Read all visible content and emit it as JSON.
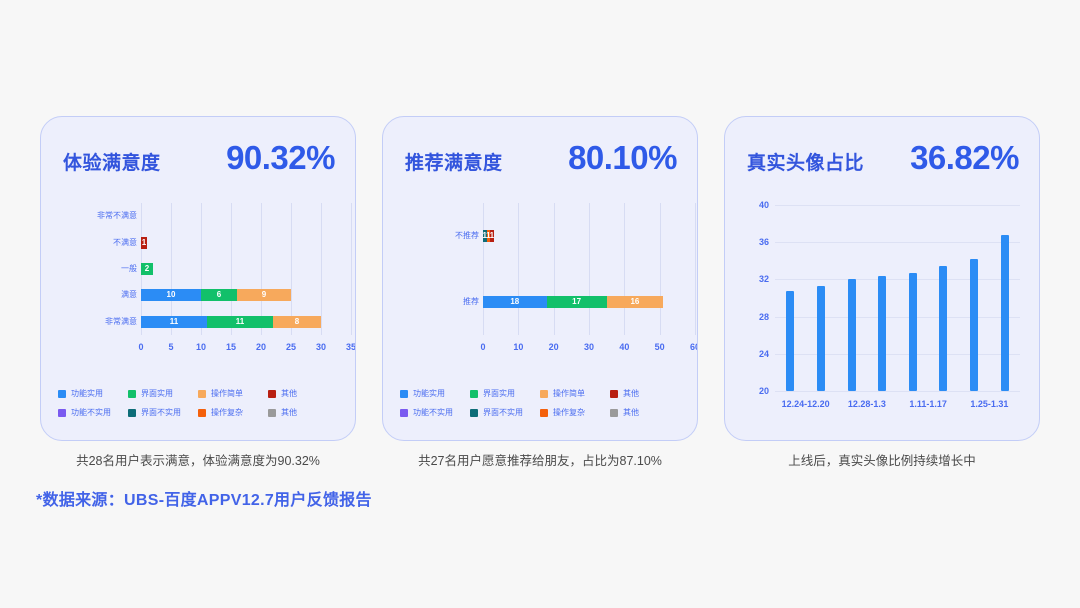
{
  "palette": {
    "page_bg": "#f7f7f7",
    "card_bg": "#edeffc",
    "card_border": "#c3cdf7",
    "accent_blue": "#2f5ae8",
    "title_blue": "#3355dd",
    "label_blue": "#4a6cf0",
    "bar_blue": "#2b8cf5",
    "bar_green": "#12c06a",
    "bar_orange": "#f7a95c",
    "bar_darkred": "#b81f12",
    "bar_purple": "#7a5af0",
    "bar_teal": "#0d6d78",
    "bar_deeporange": "#f4600c",
    "bar_gray": "#9a9a9a"
  },
  "legend_items": [
    {
      "label": "功能实用",
      "color": "#2b8cf5"
    },
    {
      "label": "界面实用",
      "color": "#12c06a"
    },
    {
      "label": "操作简单",
      "color": "#f7a95c"
    },
    {
      "label": "其他",
      "color": "#b81f12"
    },
    {
      "label": "功能不实用",
      "color": "#7a5af0"
    },
    {
      "label": "界面不实用",
      "color": "#0d6d78"
    },
    {
      "label": "操作复杂",
      "color": "#f4600c"
    },
    {
      "label": "其他",
      "color": "#9a9a9a"
    }
  ],
  "cards": [
    {
      "id": "experience-satisfaction",
      "title": "体验满意度",
      "percent": "90.32%",
      "caption": "共28名用户表示满意，体验满意度为90.32%",
      "chart_data": {
        "type": "bar",
        "orientation": "horizontal",
        "stacked": true,
        "title": "体验满意度",
        "xlabel": "",
        "ylabel": "",
        "xlim": [
          0,
          35
        ],
        "xticks": [
          0,
          5,
          10,
          15,
          20,
          25,
          30,
          35
        ],
        "grid": true,
        "categories": [
          "非常不满意",
          "不满意",
          "一般",
          "满意",
          "非常满意"
        ],
        "series": [
          {
            "name": "功能实用",
            "color": "#2b8cf5",
            "values": [
              0,
              0,
              0,
              10,
              11
            ]
          },
          {
            "name": "界面实用",
            "color": "#12c06a",
            "values": [
              0,
              0,
              2,
              6,
              11
            ]
          },
          {
            "name": "操作简单",
            "color": "#f7a95c",
            "values": [
              0,
              0,
              0,
              9,
              8
            ]
          },
          {
            "name": "其他",
            "color": "#b81f12",
            "values": [
              0,
              1,
              0,
              0,
              0
            ]
          },
          {
            "name": "功能不实用",
            "color": "#7a5af0",
            "values": [
              0,
              0,
              0,
              0,
              0
            ]
          },
          {
            "name": "界面不实用",
            "color": "#0d6d78",
            "values": [
              0,
              0,
              0,
              0,
              0
            ]
          },
          {
            "name": "操作复杂",
            "color": "#f4600c",
            "values": [
              0,
              0,
              0,
              0,
              0
            ]
          },
          {
            "name": "其他2",
            "color": "#9a9a9a",
            "values": [
              0,
              0,
              0,
              0,
              0
            ]
          }
        ]
      }
    },
    {
      "id": "recommend-satisfaction",
      "title": "推荐满意度",
      "percent": "80.10%",
      "caption": "共27名用户愿意推荐给朋友，占比为87.10%",
      "chart_data": {
        "type": "bar",
        "orientation": "horizontal",
        "stacked": true,
        "title": "推荐满意度",
        "xlabel": "",
        "ylabel": "",
        "xlim": [
          0,
          60
        ],
        "xticks": [
          0,
          10,
          20,
          30,
          40,
          50,
          60
        ],
        "grid": true,
        "categories": [
          "不推荐",
          "推荐"
        ],
        "series": [
          {
            "name": "功能实用",
            "color": "#2b8cf5",
            "values": [
              0,
              18
            ]
          },
          {
            "name": "界面实用",
            "color": "#12c06a",
            "values": [
              0,
              17
            ]
          },
          {
            "name": "操作简单",
            "color": "#f7a95c",
            "values": [
              0,
              16
            ]
          },
          {
            "name": "界面不实用",
            "color": "#0d6d78",
            "values": [
              1,
              0
            ]
          },
          {
            "name": "操作复杂",
            "color": "#f4600c",
            "values": [
              1,
              0
            ]
          },
          {
            "name": "其他",
            "color": "#b81f12",
            "values": [
              1,
              0
            ]
          }
        ]
      }
    },
    {
      "id": "real-avatar-ratio",
      "title": "真实头像占比",
      "percent": "36.82%",
      "caption": "上线后，真实头像比例持续增长中",
      "chart_data": {
        "type": "bar",
        "orientation": "vertical",
        "title": "真实头像占比",
        "xlabel": "",
        "ylabel": "",
        "ylim": [
          20,
          40
        ],
        "yticks": [
          20,
          24,
          28,
          32,
          36,
          40
        ],
        "grid": true,
        "categories": [
          "12.24-12.20",
          "",
          "12.28-1.3",
          "",
          "1.11-1.17",
          "",
          "1.25-1.31",
          ""
        ],
        "xtick_labels": [
          "12.24-12.20",
          "12.28-1.3",
          "1.11-1.17",
          "1.25-1.31"
        ],
        "values": [
          30.8,
          31.3,
          32.0,
          32.4,
          32.7,
          33.4,
          34.2,
          36.8
        ]
      }
    }
  ],
  "source_note": "*数据来源：UBS-百度APPV12.7用户反馈报告"
}
